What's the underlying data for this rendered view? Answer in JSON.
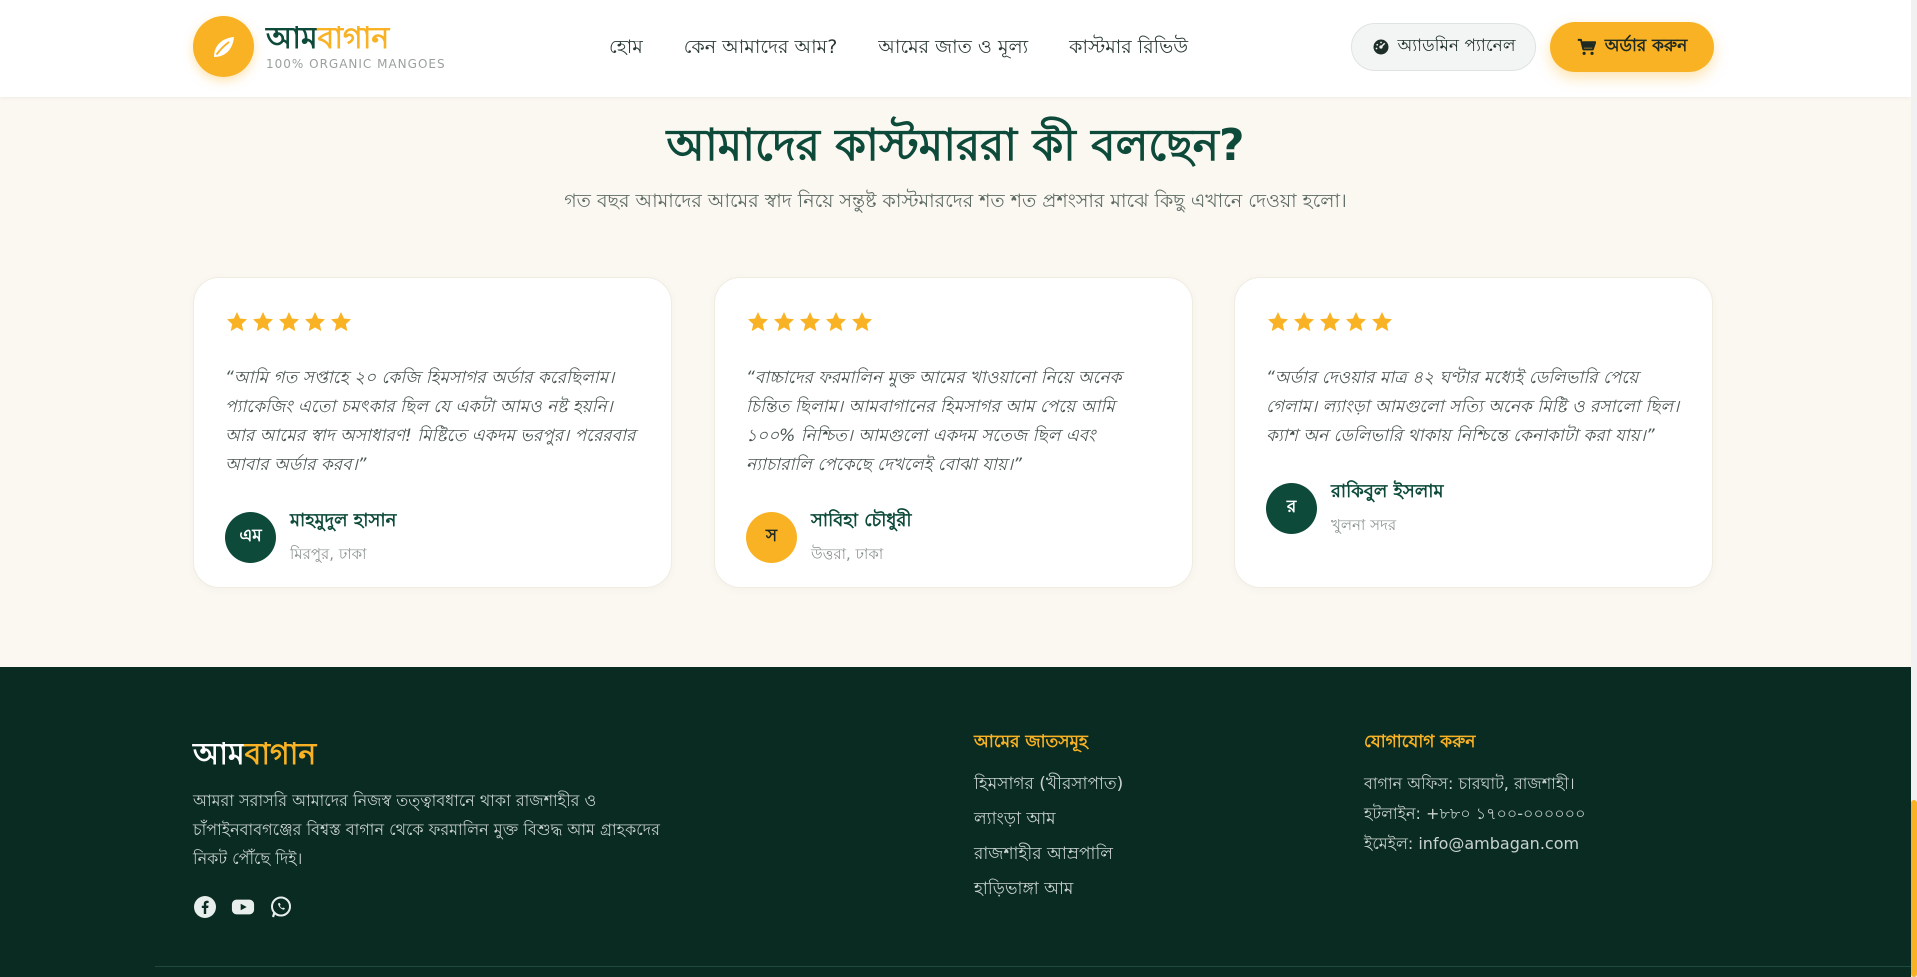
{
  "brand": {
    "name_part1": "আম",
    "name_part2": "বাগান",
    "tagline": "100% ORGANIC MANGOES",
    "accent_color": "#f9b224",
    "primary_color": "#0d4a3a",
    "logo_icon": "mango-leaf-icon"
  },
  "nav": {
    "items": [
      {
        "label": "হোম"
      },
      {
        "label": "কেন আমাদের আম?"
      },
      {
        "label": "আমের জাত ও মূল্য"
      },
      {
        "label": "কাস্টমার রিভিউ"
      }
    ],
    "admin_label": "অ্যাডমিন প্যানেল",
    "admin_icon": "gauge-icon",
    "order_label": "অর্ডার করুন",
    "order_icon": "cart-icon"
  },
  "reviews": {
    "title": "আমাদের কাস্টমাররা কী বলছেন?",
    "subtitle": "গত বছর আমাদের আমের স্বাদ নিয়ে সন্তুষ্ট কাস্টমারদের শত শত প্রশংসার মাঝে কিছু এখানে দেওয়া হলো।",
    "items": [
      {
        "rating": 5,
        "quote": "“আমি গত সপ্তাহে ২০ কেজি হিমসাগর অর্ডার করেছিলাম। প্যাকেজিং এতো চমৎকার ছিল যে একটা আমও নষ্ট হয়নি। আর আমের স্বাদ অসাধারণ! মিষ্টিতে একদম ভরপুর। পরেরবার আবার অর্ডার করব।”",
        "avatar_initial": "এম",
        "avatar_color": "#0d4a3a",
        "name": "মাহমুদুল হাসান",
        "location": "মিরপুর, ঢাকা"
      },
      {
        "rating": 5,
        "quote": "“বাচ্চাদের ফরমালিন মুক্ত আমের খাওয়ানো নিয়ে অনেক চিন্তিত ছিলাম। আমবাগানের হিমসাগর আম পেয়ে আমি ১০০% নিশ্চিত। আমগুলো একদম সতেজ ছিল এবং ন্যাচারালি পেকেছে দেখলেই বোঝা যায়।”",
        "avatar_initial": "স",
        "avatar_color": "#f9b224",
        "name": "সাবিহা চৌধুরী",
        "location": "উত্তরা, ঢাকা"
      },
      {
        "rating": 5,
        "quote": "“অর্ডার দেওয়ার মাত্র ৪২ ঘণ্টার মধ্যেই ডেলিভারি পেয়ে গেলাম। ল্যাংড়া আমগুলো সত্যি অনেক মিষ্টি ও রসালো ছিল। ক্যাশ অন ডেলিভারি থাকায় নিশ্চিন্তে কেনাকাটা করা যায়।”",
        "avatar_initial": "র",
        "avatar_color": "#0d4a3a",
        "name": "রাকিবুল ইসলাম",
        "location": "খুলনা সদর"
      }
    ]
  },
  "footer": {
    "logo_part1": "আম",
    "logo_part2": "বাগান",
    "description": "আমরা সরাসরি আমাদের নিজস্ব তত্ত্বাবধানে থাকা রাজশাহীর ও চাঁপাইনবাবগঞ্জের বিশ্বস্ত বাগান থেকে ফরমালিন মুক্ত বিশুদ্ধ আম গ্রাহকদের নিকট পৌঁছে দিই।",
    "social_icons": [
      "facebook-icon",
      "youtube-icon",
      "whatsapp-icon"
    ],
    "varieties_title": "আমের জাতসমূহ",
    "varieties": [
      {
        "label": "হিমসাগর (খীরসাপাত)"
      },
      {
        "label": "ল্যাংড়া আম"
      },
      {
        "label": "রাজশাহীর আম্রপালি"
      },
      {
        "label": "হাড়িভাঙ্গা আম"
      }
    ],
    "contact_title": "যোগাযোগ করুন",
    "contact": {
      "office": "বাগান অফিস: চারঘাট, রাজশাহী।",
      "hotline": "হটলাইন: +৮৮০ ১৭০০-০০০০০০",
      "email": "ইমেইল: info@ambagan.com"
    }
  }
}
